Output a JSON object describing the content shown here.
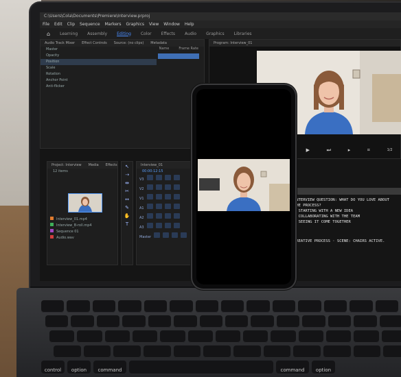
{
  "app": {
    "title": "C:\\Users\\Cola\\Documents\\Premiere\\Interview.prproj",
    "menu": [
      "File",
      "Edit",
      "Clip",
      "Sequence",
      "Markers",
      "Graphics",
      "View",
      "Window",
      "Help"
    ],
    "workspaces": [
      "Learning",
      "Assembly",
      "Editing",
      "Color",
      "Effects",
      "Audio",
      "Graphics",
      "Libraries"
    ],
    "active_workspace": "Editing"
  },
  "source_panel": {
    "tabs": [
      "Audio Track Mixer",
      "Effect Controls",
      "Source: (no clips)",
      "Metadata"
    ],
    "column_headers": [
      "Name",
      "Frame Rate"
    ],
    "rows": [
      {
        "label": "Master",
        "value": "",
        "selected": false
      },
      {
        "label": "Opacity",
        "value": "",
        "selected": false
      },
      {
        "label": "Position",
        "value": "",
        "selected": true
      },
      {
        "label": "Scale",
        "value": "",
        "selected": false
      },
      {
        "label": "Rotation",
        "value": "",
        "selected": false
      },
      {
        "label": "Anchor Point",
        "value": "",
        "selected": false
      },
      {
        "label": "Anti-flicker",
        "value": "",
        "selected": false
      }
    ]
  },
  "program": {
    "tab": "Program: Interview_01",
    "timecode": "1/2"
  },
  "project_panel": {
    "tabs": [
      "Project: Interview",
      "Media",
      "Effects"
    ],
    "item_count": "12 items",
    "clips": [
      "Interview_01.mp4",
      "Interview_B-roll.mp4",
      "Sequence 01",
      "Audio.wav"
    ]
  },
  "timeline": {
    "tab": "Interview_01",
    "timecode": "00:00:12:15",
    "tracks": [
      "V3",
      "V2",
      "V1",
      "A1",
      "A2",
      "A3",
      "Master"
    ]
  },
  "captions": {
    "lines": [
      "INTERVIEW QUESTION: WHAT DO YOU LOVE ABOUT",
      "THE PROCESS?",
      "• STARTING WITH A NEW IDEA",
      "• COLLABORATING WITH THE TEAM",
      "• SEEING IT COME TOGETHER"
    ],
    "footer": "CREATIVE PROCESS · SCENE: CHAIRS ACTIVE."
  },
  "keyboard": {
    "labels": [
      "control",
      "option",
      "command",
      "command",
      "option"
    ]
  },
  "colors": {
    "accent": "#4a8dff",
    "sweater": "#3a6fc2"
  }
}
